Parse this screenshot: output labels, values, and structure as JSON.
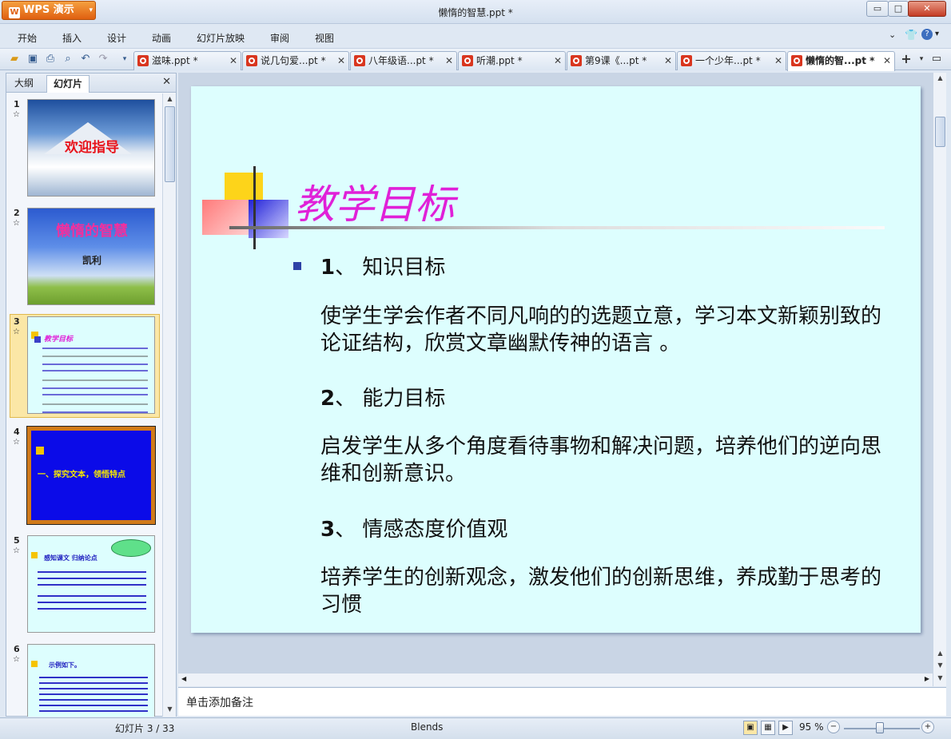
{
  "app": {
    "brand": "WPS 演示",
    "window_title": "懒惰的智慧.ppt *"
  },
  "window_controls": {
    "minimize": "▭",
    "maximize": "□",
    "close": "✕"
  },
  "menu": [
    "开始",
    "插入",
    "设计",
    "动画",
    "幻灯片放映",
    "审阅",
    "视图"
  ],
  "tabs": [
    {
      "label": "滋味.ppt *"
    },
    {
      "label": "说几句爱...pt *"
    },
    {
      "label": "八年级语...pt *"
    },
    {
      "label": "听潮.ppt *"
    },
    {
      "label": "第9课《...pt *"
    },
    {
      "label": "一个少年...pt *"
    },
    {
      "label": "懒惰的智...pt *"
    }
  ],
  "left_panel": {
    "tab_outline": "大纲",
    "tab_slides": "幻灯片",
    "close": "✕"
  },
  "thumbnails": [
    {
      "num": "1",
      "text": "欢迎指导"
    },
    {
      "num": "2",
      "text": "懒惰的智慧",
      "sub": "凯利"
    },
    {
      "num": "3",
      "text": "教学目标"
    },
    {
      "num": "4",
      "text": "一、探究文本，领悟特点"
    },
    {
      "num": "5",
      "text": "感知课文 归纳论点"
    },
    {
      "num": "6",
      "text": "示例如下。"
    }
  ],
  "slide": {
    "title": "教学目标",
    "h1_num": "1",
    "h1_text": "、 知识目标",
    "p1": "使学生学会作者不同凡响的的选题立意，学习本文新颖别致的论证结构，欣赏文章幽默传神的语言 。",
    "h2_num": "2",
    "h2_text": "、 能力目标",
    "p2": "启发学生从多个角度看待事物和解决问题，培养他们的逆向思维和创新意识。",
    "h3_num": "3",
    "h3_text": "、 情感态度价值观",
    "p3": "培养学生的创新观念，激发他们的创新思维，养成勤于思考的习惯"
  },
  "notes_placeholder": "单击添加备注",
  "status": {
    "slide_info": "幻灯片 3 / 33",
    "theme": "Blends",
    "zoom": "95 %"
  },
  "colors": {
    "title": "#e020d8",
    "slide_bg": "#ddfefe",
    "bullet": "#2d42a6"
  }
}
